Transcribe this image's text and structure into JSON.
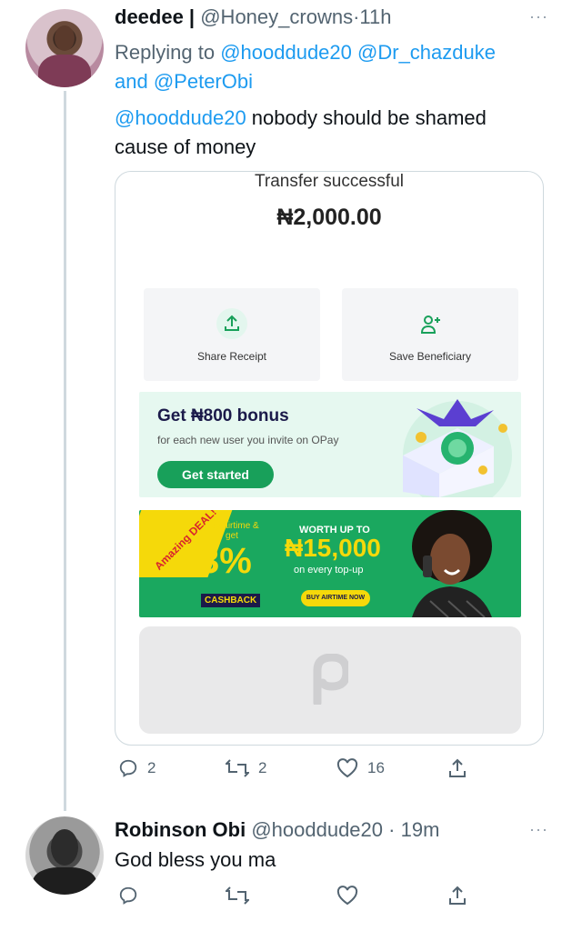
{
  "tweet": {
    "name": "deedee |",
    "handle": "@Honey_crowns",
    "separator": "·",
    "time": "11h",
    "replying_prefix": "Replying to",
    "replying_to": [
      "@hooddude20",
      "@Dr_chazduke",
      "@PeterObi"
    ],
    "replying_and": "and",
    "mention": "@hooddude20",
    "text_line1": " nobody should be shamed",
    "text_line2": "cause of money",
    "more": "···",
    "receipt": {
      "title": "Transfer successful",
      "amount": "₦2,000.00",
      "share_label": "Share Receipt",
      "save_label": "Save Beneficiary",
      "bonus_title": "Get ₦800 bonus",
      "bonus_sub": "for each new user you invite on OPay",
      "bonus_cta": "Get started",
      "promo": {
        "deal": "Amazing DEAL!",
        "buy": "Buy airtime & get",
        "percent": "3%",
        "cashback": "CASHBACK",
        "worth": "WORTH UP TO",
        "amount": "₦15,000",
        "every": "on every top-up",
        "cta": "BUY AIRTIME NOW"
      }
    },
    "reply_count": "2",
    "retweet_count": "2",
    "like_count": "16"
  },
  "reply": {
    "name": "Robinson Obi",
    "handle": "@hooddude20",
    "separator": "·",
    "time": "19m",
    "text": "God bless you ma",
    "more": "···"
  },
  "colors": {
    "link": "#1d9bf0",
    "secondary": "#536471",
    "opay_green": "#18a05a"
  }
}
